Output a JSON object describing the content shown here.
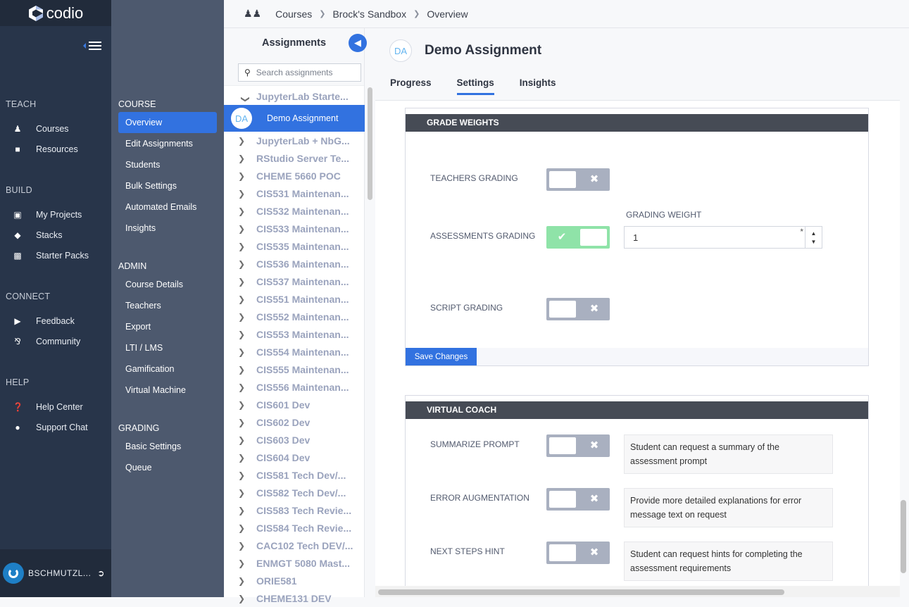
{
  "app": {
    "logo_text": "codio"
  },
  "primary_nav": {
    "sections": [
      {
        "label": "TEACH",
        "items": [
          {
            "label": "Courses",
            "icon": "users-icon"
          },
          {
            "label": "Resources",
            "icon": "folder-icon"
          }
        ]
      },
      {
        "label": "BUILD",
        "items": [
          {
            "label": "My Projects",
            "icon": "briefcase-icon"
          },
          {
            "label": "Stacks",
            "icon": "layers-icon"
          },
          {
            "label": "Starter Packs",
            "icon": "box-icon"
          }
        ]
      },
      {
        "label": "CONNECT",
        "items": [
          {
            "label": "Feedback",
            "icon": "megaphone-icon"
          },
          {
            "label": "Community",
            "icon": "community-icon"
          }
        ]
      },
      {
        "label": "HELP",
        "items": [
          {
            "label": "Help Center",
            "icon": "question-icon"
          },
          {
            "label": "Support Chat",
            "icon": "chat-icon"
          }
        ]
      }
    ],
    "user": {
      "name": "BSCHMUTZL..."
    }
  },
  "course_nav": {
    "sections": [
      {
        "label": "COURSE",
        "items": [
          "Overview",
          "Edit Assignments",
          "Students",
          "Bulk Settings",
          "Automated Emails",
          "Insights"
        ]
      },
      {
        "label": "ADMIN",
        "items": [
          "Course Details",
          "Teachers",
          "Export",
          "LTI / LMS",
          "Gamification",
          "Virtual Machine"
        ]
      },
      {
        "label": "GRADING",
        "items": [
          "Basic Settings",
          "Queue"
        ]
      }
    ],
    "active": "Overview"
  },
  "breadcrumb": [
    "Courses",
    "Brock's Sandbox",
    "Overview"
  ],
  "assignments_panel": {
    "title": "Assignments",
    "search_placeholder": "Search assignments",
    "expanded_module": "JupyterLab Starte...",
    "selected": {
      "initials": "DA",
      "label": "Demo Assignment"
    },
    "modules": [
      "JupyterLab + NbG...",
      "RStudio Server Te...",
      "CHEME 5660 POC",
      "CIS531 Maintenan...",
      "CIS532 Maintenan...",
      "CIS533 Maintenan...",
      "CIS535 Maintenan...",
      "CIS536 Maintenan...",
      "CIS537 Maintenan...",
      "CIS551 Maintenan...",
      "CIS552 Maintenan...",
      "CIS553 Maintenan...",
      "CIS554 Maintenan...",
      "CIS555 Maintenan...",
      "CIS556 Maintenan...",
      "CIS601 Dev",
      "CIS602 Dev",
      "CIS603 Dev",
      "CIS604 Dev",
      "CIS581 Tech Dev/...",
      "CIS582 Tech Dev/...",
      "CIS583 Tech Revie...",
      "CIS584 Tech Revie...",
      "CAC102 Tech DEV/...",
      "ENMGT 5080 Mast...",
      "ORIE581",
      "CHEME131 DEV"
    ]
  },
  "assignment": {
    "initials": "DA",
    "title": "Demo Assignment",
    "tabs": [
      "Progress",
      "Settings",
      "Insights"
    ],
    "active_tab": "Settings"
  },
  "grade_weights": {
    "title": "GRADE WEIGHTS",
    "rows": [
      {
        "label": "TEACHERS GRADING",
        "enabled": false
      },
      {
        "label": "ASSESSMENTS GRADING",
        "enabled": true
      },
      {
        "label": "SCRIPT GRADING",
        "enabled": false
      }
    ],
    "grading_weight_label": "GRADING WEIGHT",
    "grading_weight_value": "1",
    "required_mark": "*",
    "save_label": "Save Changes"
  },
  "virtual_coach": {
    "title": "VIRTUAL COACH",
    "rows": [
      {
        "label": "SUMMARIZE PROMPT",
        "enabled": false,
        "description": "Student can request a summary of the assessment prompt"
      },
      {
        "label": "ERROR AUGMENTATION",
        "enabled": false,
        "description": "Provide more detailed explanations for error message text on request"
      },
      {
        "label": "NEXT STEPS HINT",
        "enabled": false,
        "description": "Student can request hints for completing the assessment requirements"
      }
    ]
  },
  "colors": {
    "accent": "#3272e0",
    "toggle_on": "#8fe3a8",
    "toggle_off": "#a9b0c0",
    "section_header": "#464b55"
  }
}
